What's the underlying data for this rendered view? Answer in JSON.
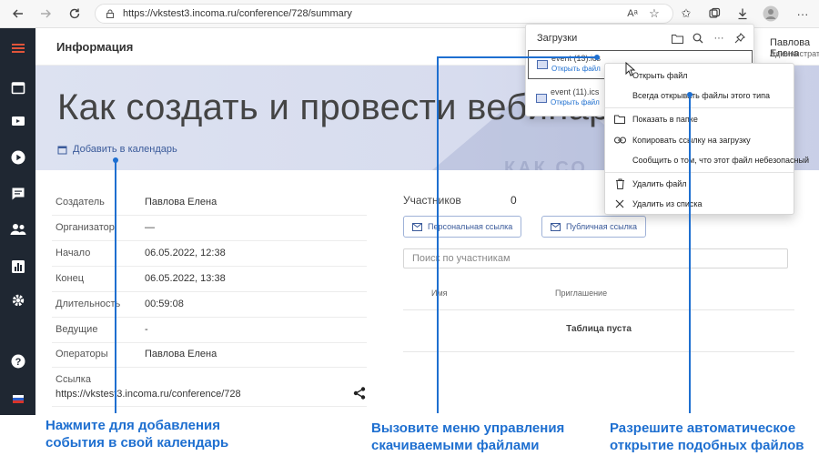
{
  "browser": {
    "url": "https://vkstest3.incoma.ru/conference/728/summary"
  },
  "header": {
    "title": "Информация",
    "user_name": "Павлова Елена",
    "user_role": "Администратор"
  },
  "hero": {
    "title": "Как создать и провести вебинар?",
    "add_to_calendar": "Добавить в календарь",
    "decor_text": "КАК СО"
  },
  "details": [
    {
      "label": "Создатель",
      "value": "Павлова Елена"
    },
    {
      "label": "Организатор",
      "value": "—"
    },
    {
      "label": "Начало",
      "value": "06.05.2022, 12:38"
    },
    {
      "label": "Конец",
      "value": "06.05.2022, 13:38"
    },
    {
      "label": "Длительность",
      "value": "00:59:08"
    },
    {
      "label": "Ведущие",
      "value": "-"
    },
    {
      "label": "Операторы",
      "value": "Павлова Елена"
    }
  ],
  "link": {
    "label": "Ссылка",
    "value": "https://vkstest3.incoma.ru/conference/728"
  },
  "participants": {
    "label": "Участников",
    "count": "0",
    "personal_link": "Персональная ссылка",
    "public_link": "Публичная ссылка",
    "search_placeholder": "Поиск по участникам",
    "col_name": "Имя",
    "col_invite": "Приглашение",
    "empty": "Таблица пуста"
  },
  "downloads": {
    "title": "Загрузки",
    "items": [
      {
        "name": "event (13).ics",
        "open": "Открыть файл"
      },
      {
        "name": "event (11).ics",
        "open": "Открыть файл"
      }
    ]
  },
  "context_menu": {
    "items": [
      "Открыть файл",
      "Всегда открывать файлы этого типа",
      "Показать в папке",
      "Копировать ссылку на загрузку",
      "Сообщить о том, что этот файл небезопасный",
      "Удалить файл",
      "Удалить из списка"
    ]
  },
  "annotations": [
    "Нажмите для добавления\nсобытия в свой календарь",
    "Вызовите меню управления\nскачиваемыми файлами",
    "Разрешите автоматическое\nоткрытие подобных файлов"
  ],
  "colors": {
    "accent": "#1e6fd0",
    "nav_bg": "#1f2732",
    "nav_active": "#e0543a",
    "link": "#3a5a9a"
  }
}
